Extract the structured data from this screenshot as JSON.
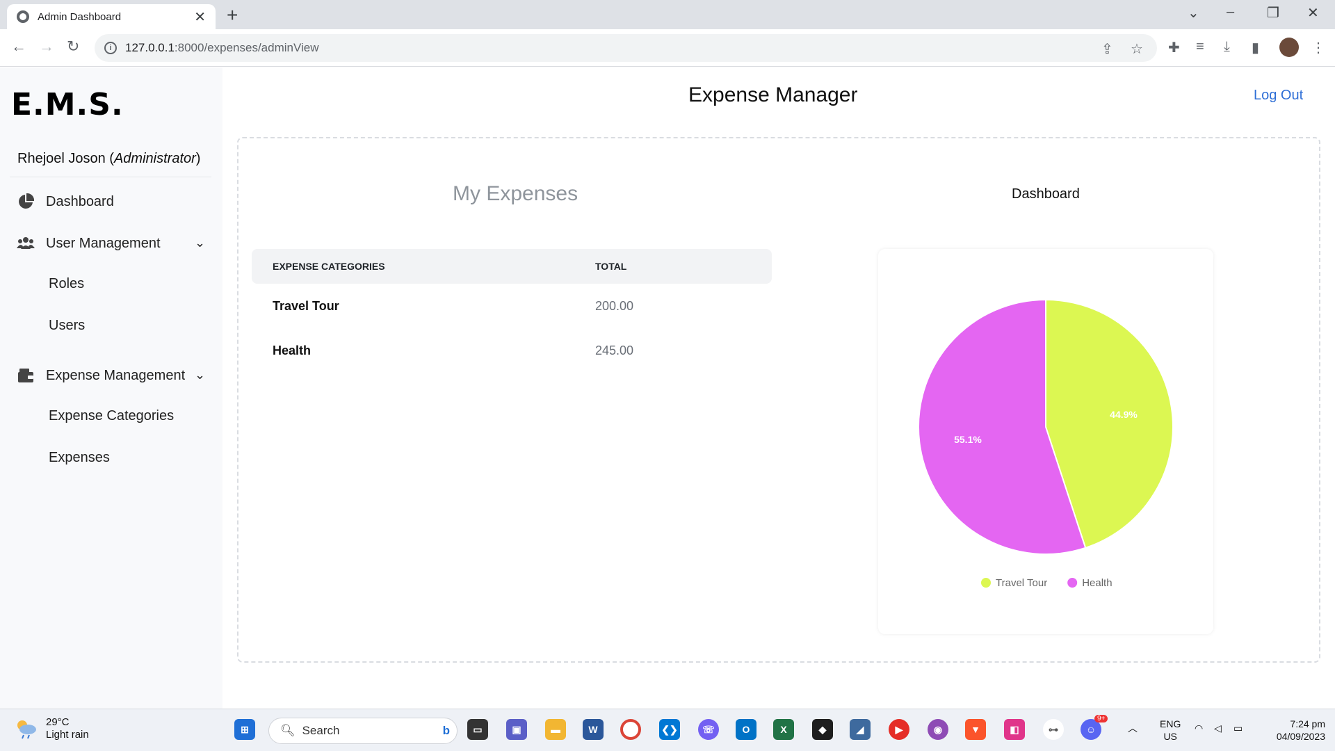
{
  "browser": {
    "tab_title": "Admin Dashboard",
    "url_host": "127.0.0.1",
    "url_rest": ":8000/expenses/adminView"
  },
  "app": {
    "brand": "E.M.S.",
    "user_name": "Rhejoel Joson",
    "user_role": "Administrator",
    "page_title": "Expense Manager",
    "logout_label": "Log Out"
  },
  "sidebar": {
    "dashboard": "Dashboard",
    "user_management": "User Management",
    "roles": "Roles",
    "users": "Users",
    "expense_management": "Expense Management",
    "expense_categories": "Expense Categories",
    "expenses": "Expenses"
  },
  "main": {
    "my_expenses_title": "My Expenses",
    "dashboard_title": "Dashboard",
    "table": {
      "headers": [
        "EXPENSE CATEGORIES",
        "TOTAL"
      ],
      "rows": [
        {
          "category": "Travel Tour",
          "total": "200.00"
        },
        {
          "category": "Health",
          "total": "245.00"
        }
      ]
    }
  },
  "chart_data": {
    "type": "pie",
    "categories": [
      "Travel Tour",
      "Health"
    ],
    "values": [
      200,
      245
    ],
    "percent_labels": [
      "44.9%",
      "55.1%"
    ],
    "colors": [
      "#dcf752",
      "#e466f2"
    ],
    "legend": "bottom"
  },
  "taskbar": {
    "temperature": "29°C",
    "weather": "Light rain",
    "search_placeholder": "Search",
    "language": "ENG",
    "region": "US",
    "time": "7:24 pm",
    "date": "04/09/2023",
    "notification_badge": "9+"
  }
}
